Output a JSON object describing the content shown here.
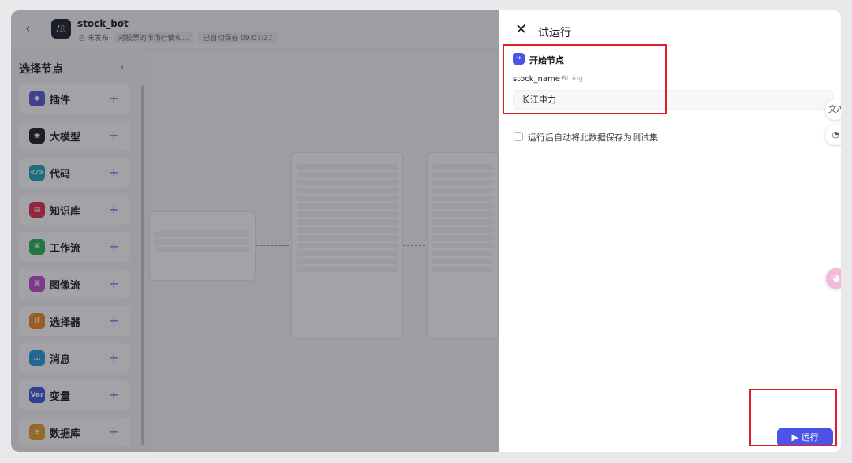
{
  "header": {
    "bot_name": "stock_bot",
    "status": "◎ 未发布",
    "description": "对股票的市场行情和...",
    "autosave": "已自动保存 09:07:37"
  },
  "left_panel": {
    "title": "选择节点",
    "items": [
      {
        "label": "插件",
        "icon": "plugin-icon",
        "color": "#5b5bd6",
        "glyph": "◆"
      },
      {
        "label": "大模型",
        "icon": "llm-icon",
        "color": "#222222",
        "glyph": "◉"
      },
      {
        "label": "代码",
        "icon": "code-icon",
        "color": "#1fa4b8",
        "glyph": "</>"
      },
      {
        "label": "知识库",
        "icon": "knowledge-icon",
        "color": "#e0344c",
        "glyph": "▤"
      },
      {
        "label": "工作流",
        "icon": "workflow-icon",
        "color": "#28b35a",
        "glyph": "⌘"
      },
      {
        "label": "图像流",
        "icon": "imageflow-icon",
        "color": "#c24fd0",
        "glyph": "⌘"
      },
      {
        "label": "选择器",
        "icon": "selector-icon",
        "color": "#f08a24",
        "glyph": "If"
      },
      {
        "label": "消息",
        "icon": "message-icon",
        "color": "#2a9be0",
        "glyph": "…"
      },
      {
        "label": "变量",
        "icon": "variable-icon",
        "color": "#3b5bdb",
        "glyph": "Var"
      },
      {
        "label": "数据库",
        "icon": "database-icon",
        "color": "#e5a028",
        "glyph": "≋"
      }
    ]
  },
  "run_panel": {
    "title": "试运行",
    "start_node": "开始节点",
    "field_name": "stock_name",
    "field_type": "String",
    "field_value": "长江电力",
    "save_checkbox_label": "运行后自动将此数据保存为测试集",
    "run_button": "运行"
  },
  "colors": {
    "accent": "#4d53e8",
    "highlight": "#e11d2a"
  }
}
